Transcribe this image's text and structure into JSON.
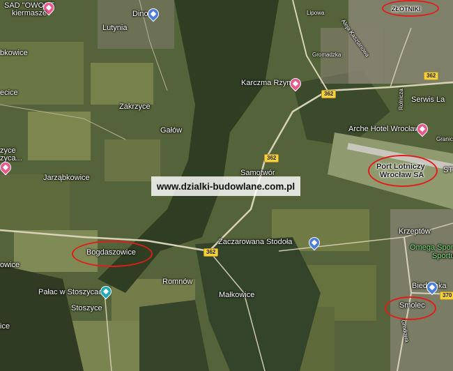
{
  "map": {
    "type": "satellite",
    "colors": {
      "field_dark": "#4a5a32",
      "forest": "#2f3e22",
      "field_light": "#7f8a52",
      "urban": "#9a9588",
      "road": "#d8d2b8",
      "highlight": "#e21c1c"
    }
  },
  "labels": {
    "sad_owoce": "SAD \"OWOCE",
    "kiermasze": "kiermasze",
    "dino": "Dino",
    "lutynia": "Lutynia",
    "zlotniki": "ZŁOTNIKI",
    "bkowice": "bkowice",
    "ecice": "ecice",
    "karczma_rzym": "Karczma Rzym",
    "serwis_la": "Serwis La",
    "zakrzyce": "Zakrzyce",
    "galow": "Gałów",
    "arche_hotel": "Arche Hotel Wrocław",
    "zyce": "zyce",
    "zyce2": "zyca...",
    "samotwor": "Samotwór",
    "port_lotniczy_1": "Port Lotniczy",
    "port_lotniczy_2": "Wrocław SA",
    "jarzabkowice": "Jarząbkowice",
    "watermark": "www.dzialki-budowlane.com.pl",
    "krzeptow": "Krzeptów",
    "zaczarowana_stodola": "Zaczarowana Stodoła",
    "omega_1": "Omega Sport C",
    "omega_2": "Sportu",
    "bogdaszowice": "Bogdaszowice",
    "owice": "owice",
    "romnow": "Romnów",
    "biedronka": "Biedronka",
    "palac": "Pałac w Stoszycach",
    "malkowice": "Małkowice",
    "smolec": "Smolec",
    "stoszyce": "Stoszyce",
    "ice": "ice",
    "gromadzka": "Gromadzka",
    "aleja": "Aleja Kasztanowa",
    "rolnicza": "Rolnicza",
    "granicz": "Granicz",
    "st": "ST",
    "lipowa": "Lipowa",
    "grodowa": "Grodowa"
  },
  "road_shields": {
    "r362_a": "362",
    "r362_b": "362",
    "r362_c": "362",
    "r362_d": "362",
    "r370": "370"
  },
  "highlighted_places": [
    "ZŁOTNIKI",
    "Port Lotniczy Wrocław SA",
    "Bogdaszowice",
    "Smolec"
  ]
}
